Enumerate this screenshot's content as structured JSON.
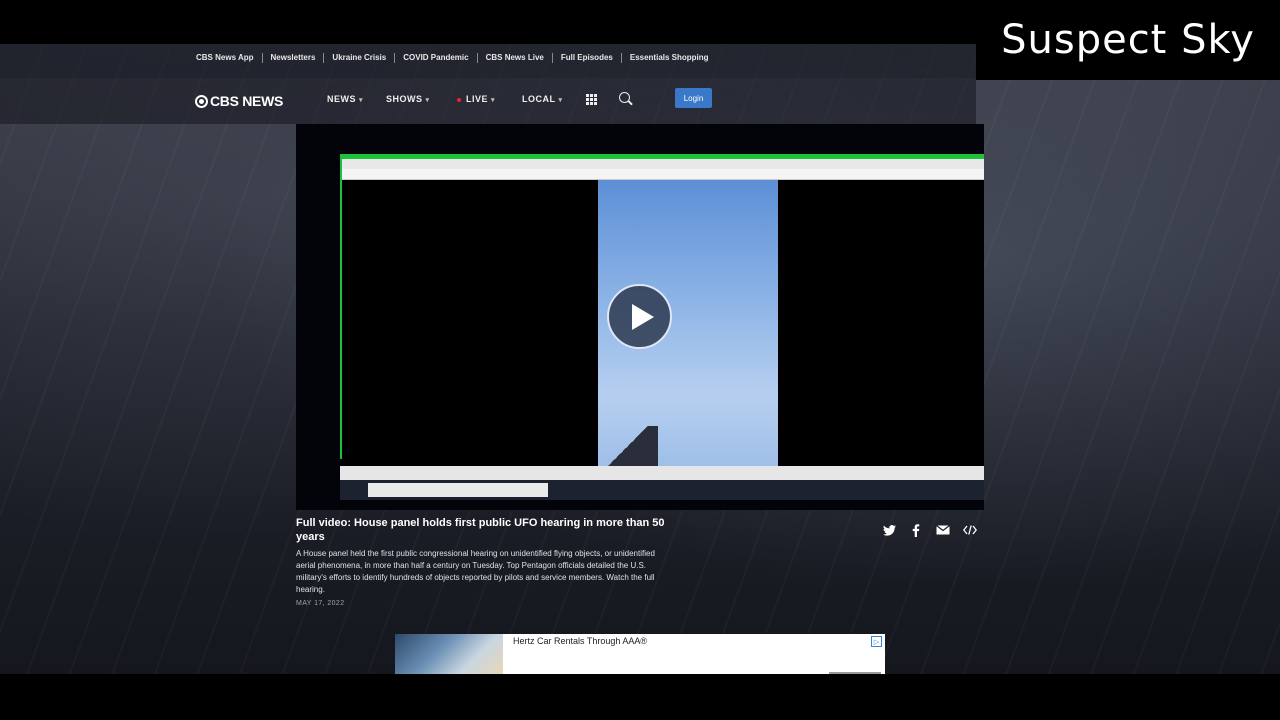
{
  "top_links": [
    "CBS News App",
    "Newsletters",
    "Ukraine Crisis",
    "COVID Pandemic",
    "CBS News Live",
    "Full Episodes",
    "Essentials Shopping"
  ],
  "logo": "CBS NEWS",
  "nav": {
    "news": "NEWS",
    "shows": "SHOWS",
    "live": "LIVE",
    "local": "LOCAL",
    "login": "Login"
  },
  "article": {
    "title": "Full video: House panel holds first public UFO hearing in more than 50 years",
    "description": "A House panel held the first public congressional hearing on unidentified flying objects, or unidentified aerial phenomena, in more than half a century on Tuesday. Top Pentagon officials detailed the U.S. military's efforts to identify hundreds of objects reported by pilots and service members. Watch the full hearing.",
    "date": "MAY 17, 2022"
  },
  "ad": {
    "text": "Hertz Car Rentals Through AAA®"
  },
  "overlay_brand": "Suspect Sky",
  "icons": {
    "twitter": "twitter-icon",
    "facebook": "facebook-icon",
    "email": "email-icon",
    "embed": "embed-icon",
    "play": "play-icon",
    "search": "search-icon",
    "grid": "grid-icon"
  },
  "colors": {
    "login_button": "#3a78c9",
    "live_dot": "#e22233",
    "video_window_green": "#1ec23a"
  }
}
